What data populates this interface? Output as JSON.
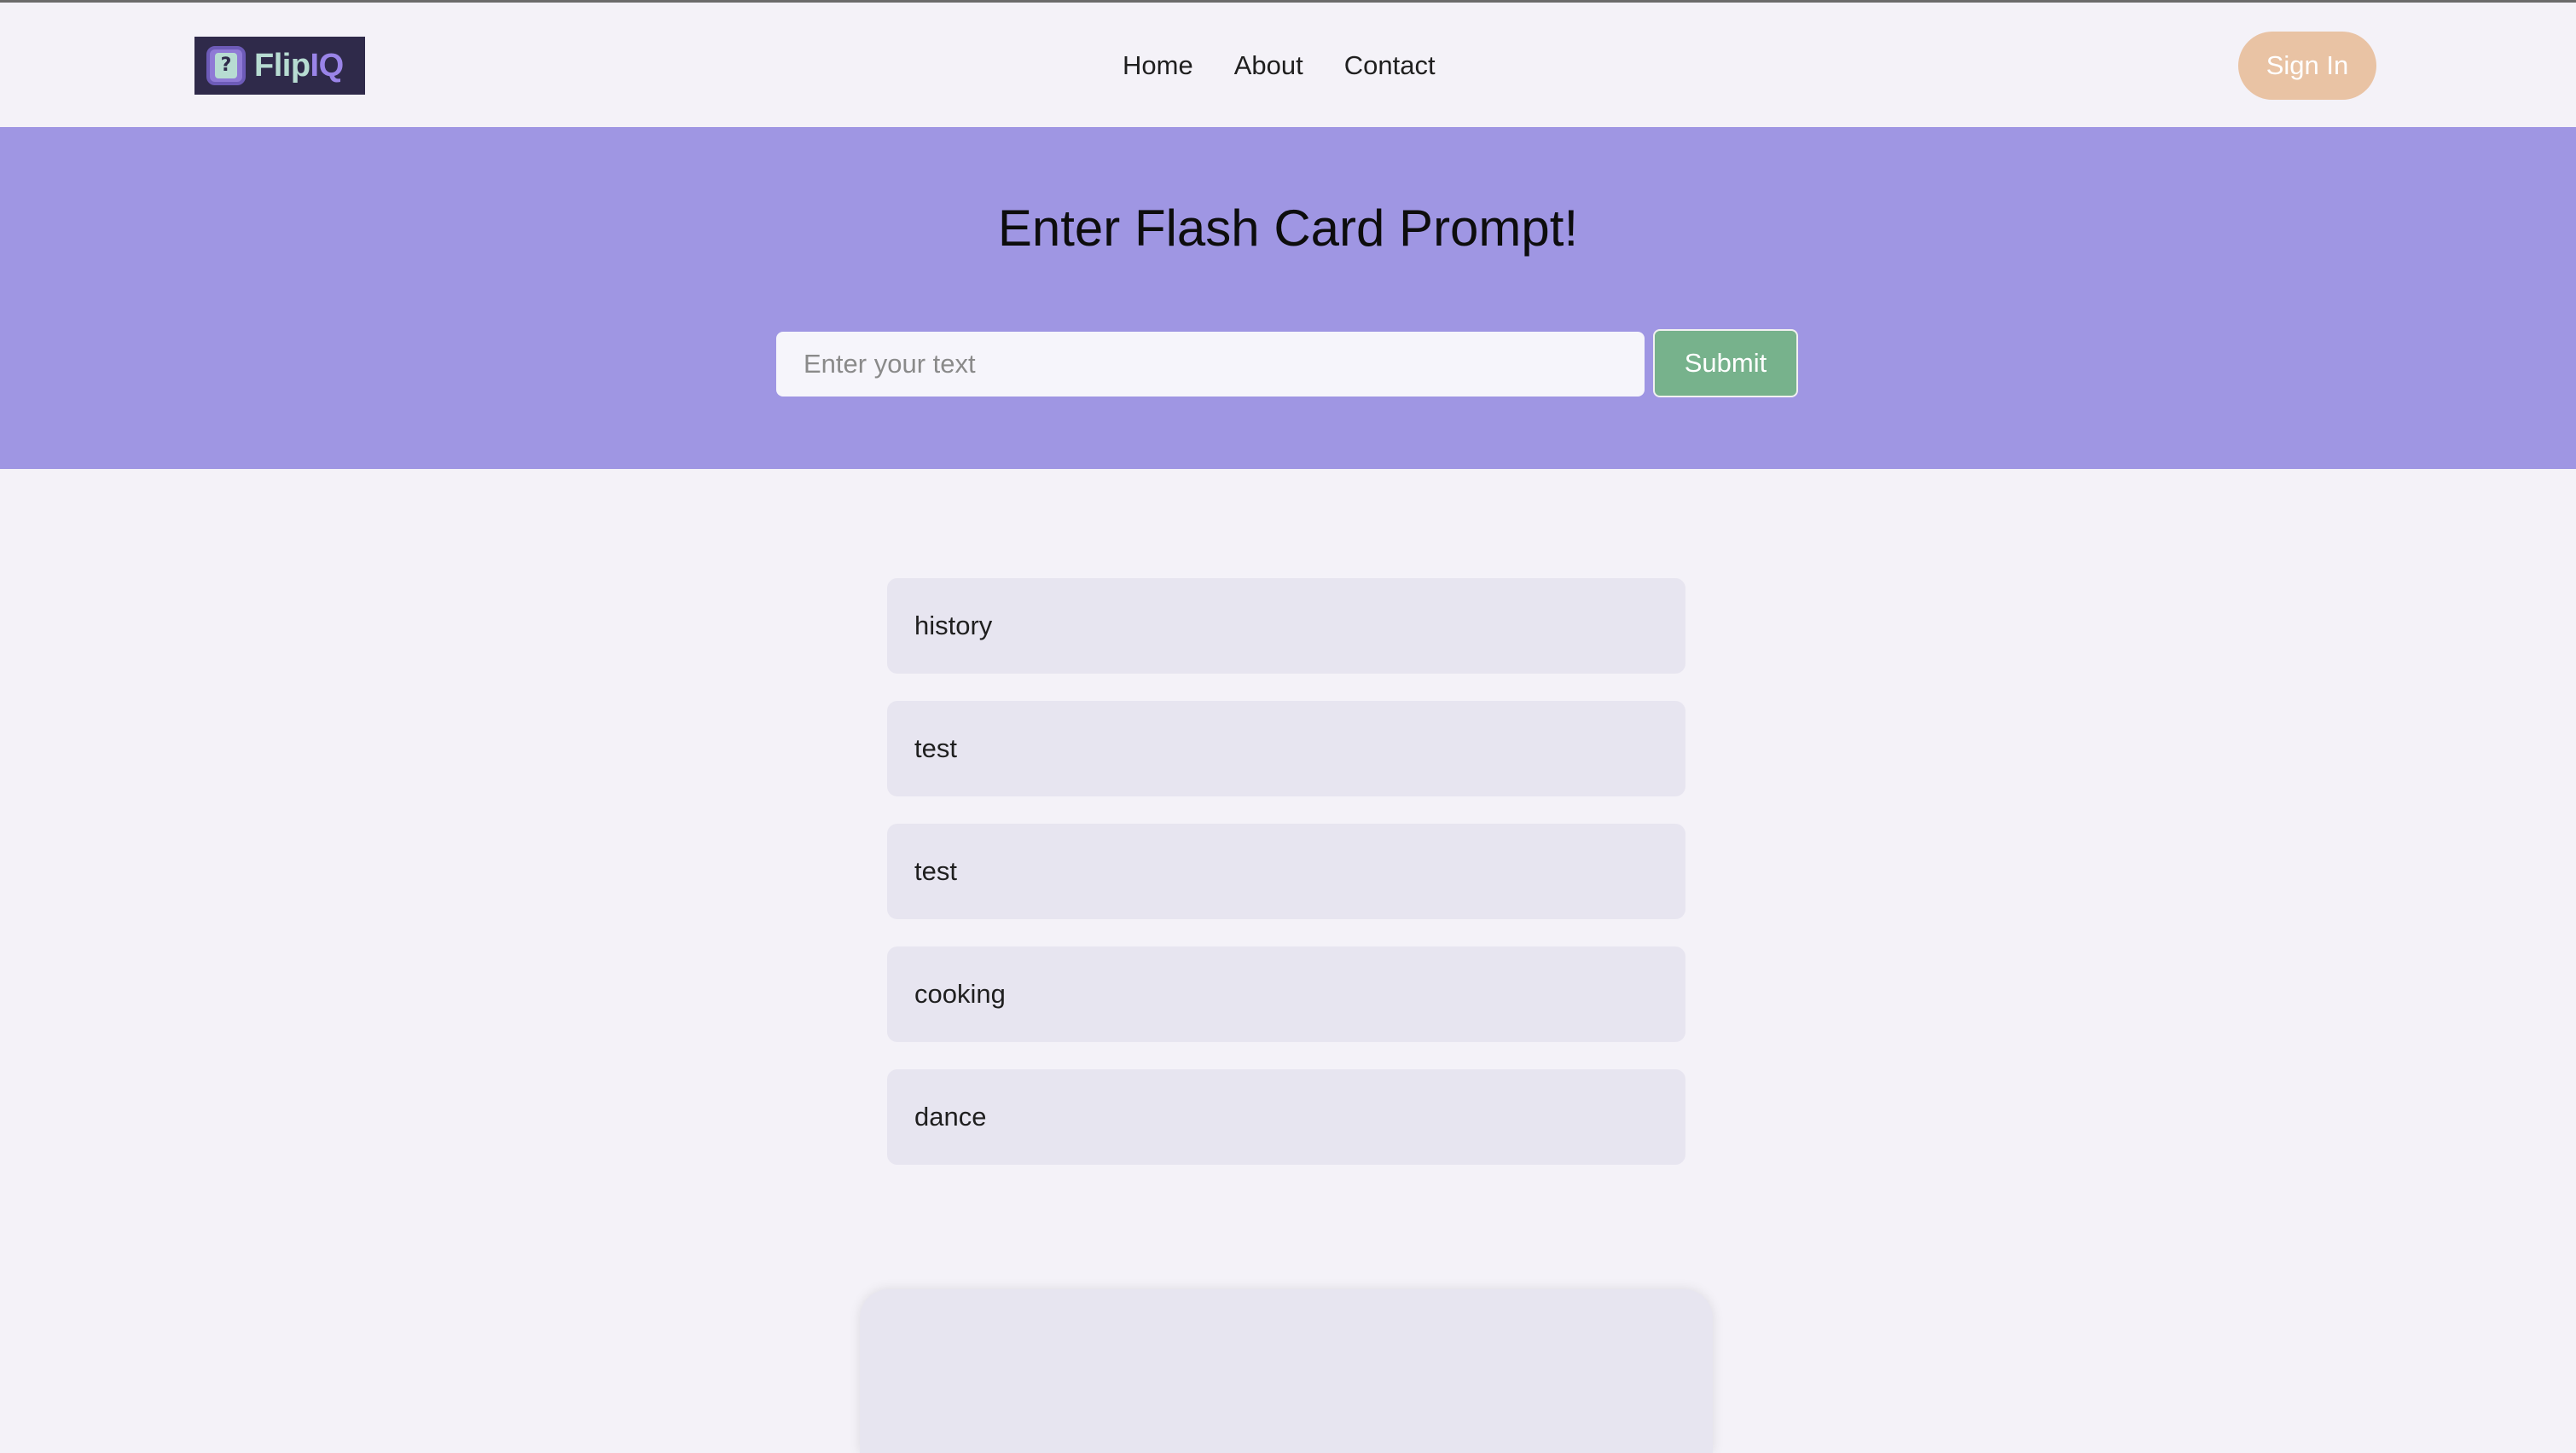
{
  "header": {
    "logo": {
      "icon": "question-mark-icon",
      "text_part1": "Flip",
      "text_part2": "IQ"
    },
    "nav": [
      {
        "label": "Home"
      },
      {
        "label": "About"
      },
      {
        "label": "Contact"
      }
    ],
    "sign_in_label": "Sign In"
  },
  "hero": {
    "title": "Enter Flash Card Prompt!",
    "input_placeholder": "Enter your text",
    "input_value": "",
    "submit_label": "Submit"
  },
  "topics": [
    {
      "label": "history"
    },
    {
      "label": "test"
    },
    {
      "label": "test"
    },
    {
      "label": "cooking"
    },
    {
      "label": "dance"
    }
  ],
  "colors": {
    "page_background": "#f4f2f8",
    "hero_background": "#9f96e3",
    "submit_button": "#77b28c",
    "sign_in_button": "#e9c3a4",
    "topic_item": "#e7e5f0",
    "logo_background": "#2f2a4a"
  }
}
